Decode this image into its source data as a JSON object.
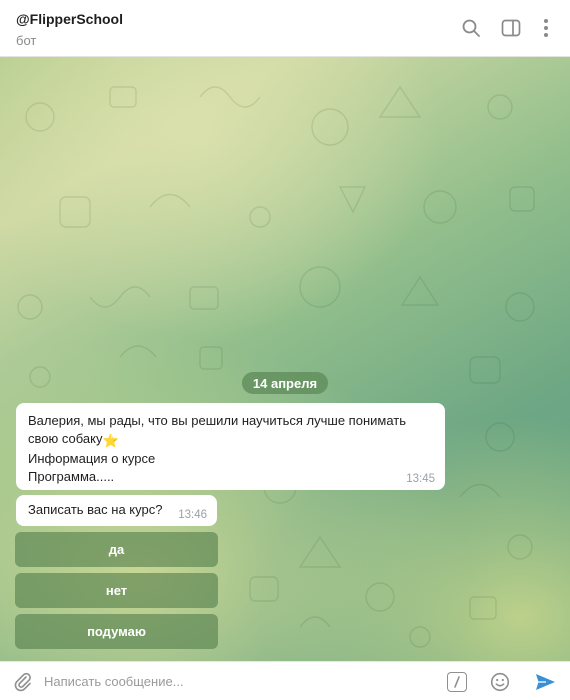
{
  "header": {
    "title": "@FlipperSchool",
    "subtitle": "бот",
    "icons": [
      "search-icon",
      "sidebar-toggle-icon",
      "more-vertical-icon"
    ]
  },
  "chat": {
    "date": "14 апреля",
    "messages": [
      {
        "lines": [
          "Валерия, мы рады, что вы решили научиться лучше понимать",
          "свою собаку",
          "Информация о курсе",
          "Программа....."
        ],
        "emoji": "⭐",
        "time": "13:45"
      },
      {
        "text": "Записать вас на курс?",
        "time": "13:46"
      }
    ],
    "keyboard": [
      "да",
      "нет",
      "подумаю"
    ]
  },
  "composer": {
    "placeholder": "Написать сообщение...",
    "icons": [
      "paperclip-icon",
      "bot-command-icon",
      "emoji-icon",
      "send-icon"
    ]
  },
  "colors": {
    "accent": "#3a90d6",
    "keyboard_button": "#56804e",
    "date_pill": "#5d8a58"
  }
}
